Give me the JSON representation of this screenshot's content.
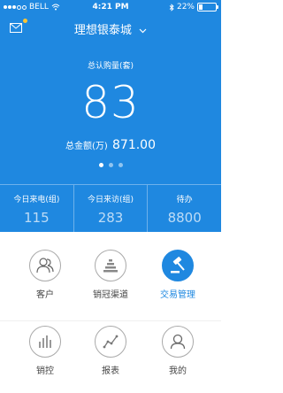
{
  "status_bar": {
    "carrier": "BELL",
    "time": "4:21 PM",
    "battery_percent": "22%",
    "battery_level": 0.22
  },
  "nav": {
    "title": "理想银泰城"
  },
  "hero": {
    "metric_label": "总认购量(套)",
    "metric_value": "83",
    "amount_label": "总金额(万)",
    "amount_value": "871.00",
    "pages": 3,
    "active_page": 1
  },
  "stats": [
    {
      "label": "今日来电(组)",
      "value": "115"
    },
    {
      "label": "今日来访(组)",
      "value": "283"
    },
    {
      "label": "待办",
      "value": "8800"
    }
  ],
  "menu": [
    {
      "label": "客户",
      "icon": "users-icon",
      "active": false
    },
    {
      "label": "销冠渠道",
      "icon": "pyramid-icon",
      "active": false
    },
    {
      "label": "交易管理",
      "icon": "gavel-icon",
      "active": true
    },
    {
      "label": "销控",
      "icon": "bar-chart-icon",
      "active": false
    },
    {
      "label": "报表",
      "icon": "trend-line-icon",
      "active": false
    },
    {
      "label": "我的",
      "icon": "user-icon",
      "active": false
    }
  ],
  "colors": {
    "brand": "#1f88e0",
    "badge": "#ffc431"
  }
}
